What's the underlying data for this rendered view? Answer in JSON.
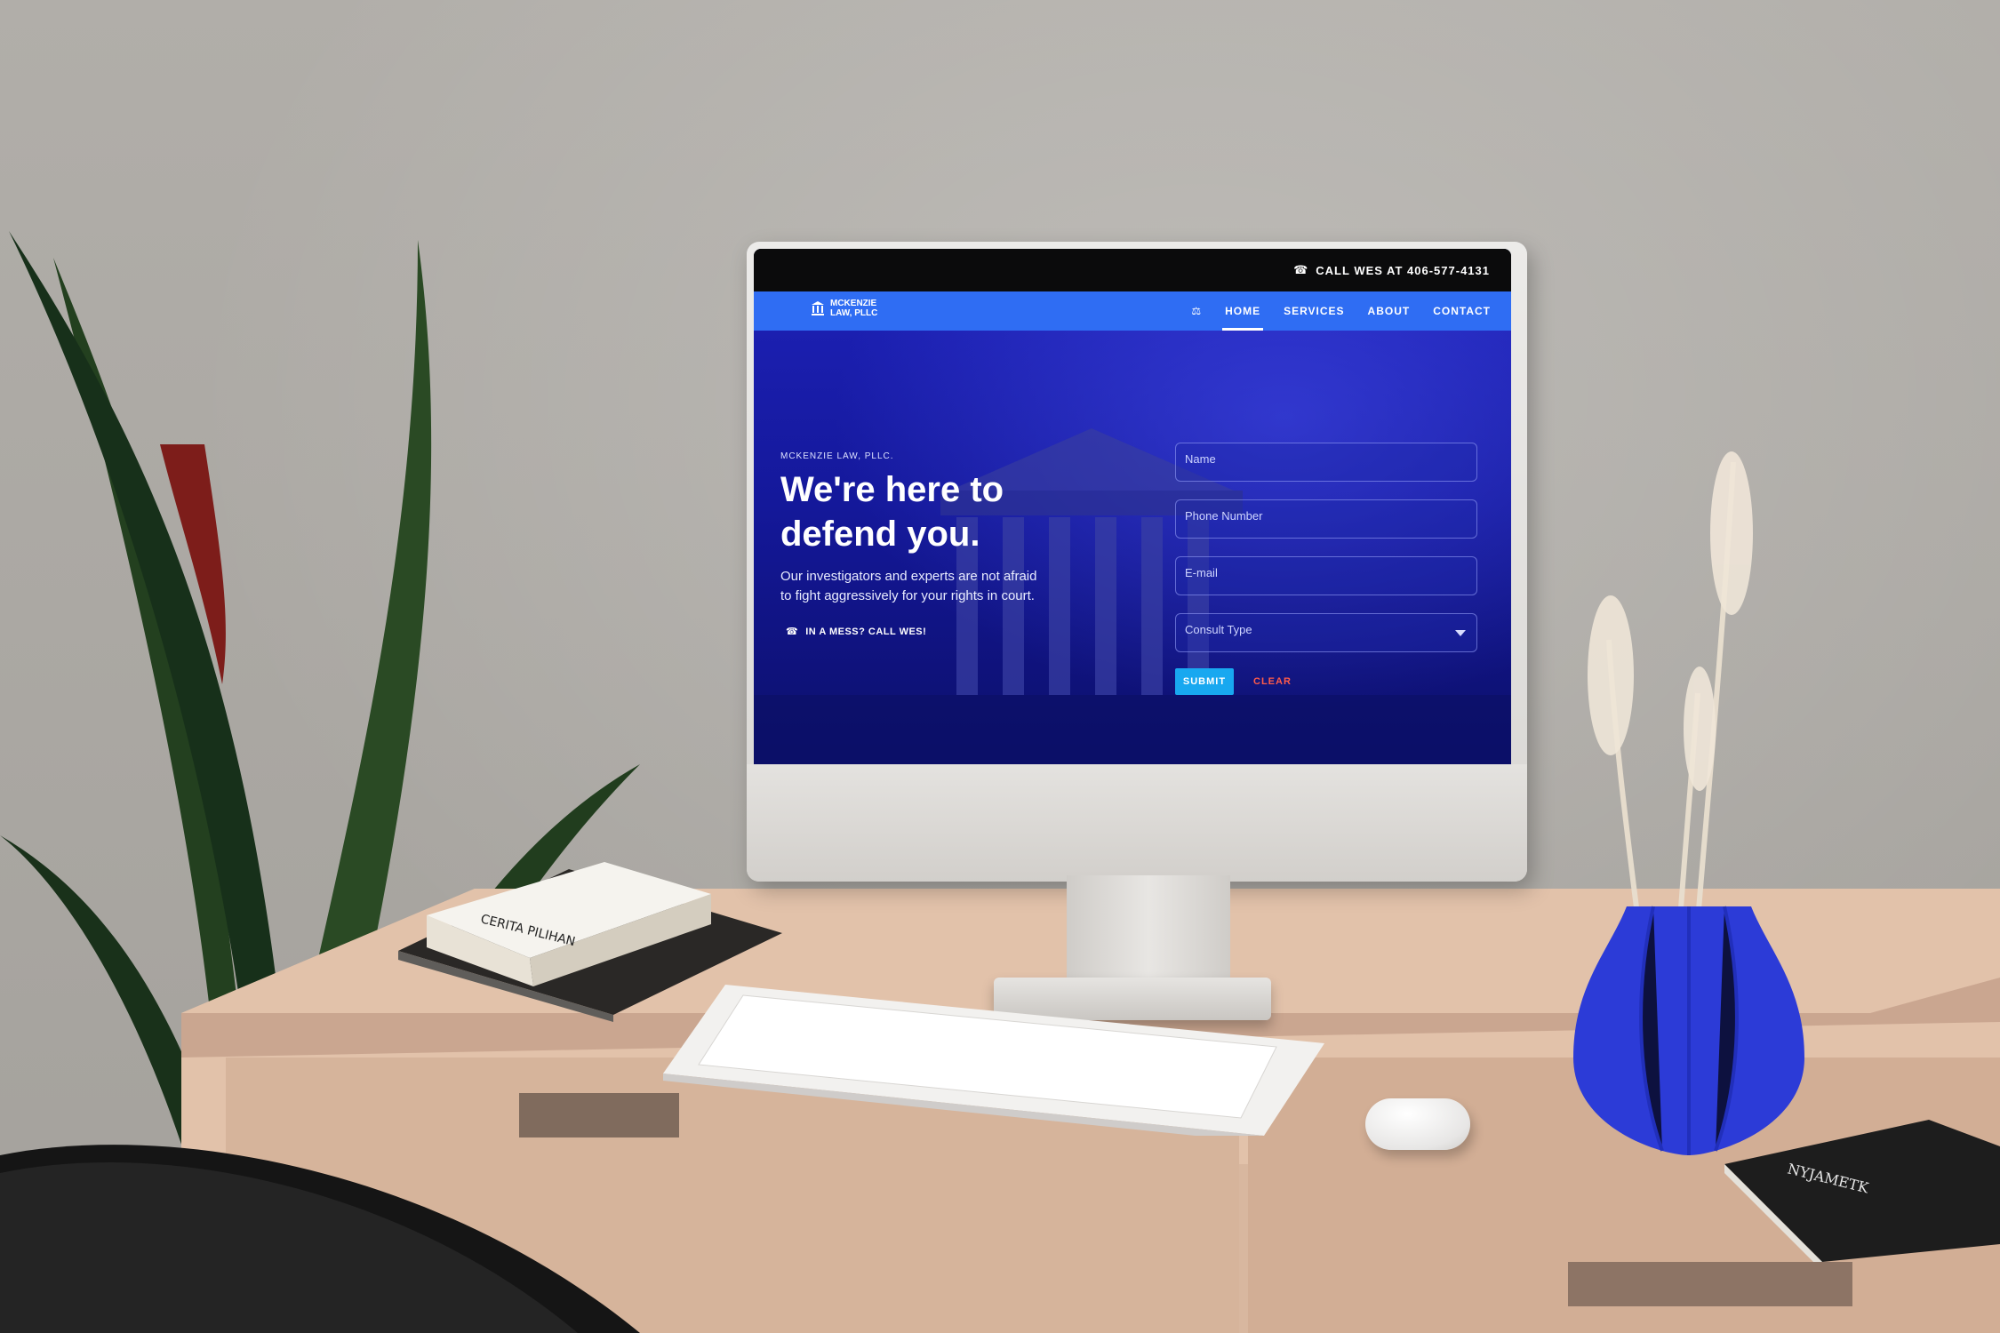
{
  "website": {
    "topbar": {
      "phone_label": "CALL WES AT 406-577-4131",
      "phone_icon": "phone-icon"
    },
    "brand": {
      "line1": "MCKENZIE",
      "line2": "LAW, PLLC",
      "logo_icon": "courthouse-icon"
    },
    "nav": {
      "toggle_icon": "theme-toggle-icon",
      "items": [
        {
          "label": "HOME",
          "active": true
        },
        {
          "label": "SERVICES",
          "active": false
        },
        {
          "label": "ABOUT",
          "active": false
        },
        {
          "label": "CONTACT",
          "active": false
        }
      ]
    },
    "hero": {
      "eyebrow": "MCKENZIE LAW, PLLC.",
      "headline": "We're here to defend you.",
      "subheadline": "Our investigators and experts are not afraid to fight aggressively for your rights in court.",
      "cta_label": "IN A MESS? CALL WES!",
      "cta_icon": "phone-icon"
    },
    "form": {
      "name_placeholder": "Name",
      "phone_placeholder": "Phone Number",
      "email_placeholder": "E-mail",
      "consult_placeholder": "Consult Type",
      "submit_label": "SUBMIT",
      "clear_label": "CLEAR"
    },
    "colors": {
      "navbar": "#2f6df3",
      "hero_overlay": "#1b1fb0",
      "submit": "#18a8f0",
      "clear": "#ff5b4a"
    }
  },
  "scene": {
    "book_left_title": "CERITA PILIHAN",
    "book_right_title": "NYJAMETK"
  }
}
